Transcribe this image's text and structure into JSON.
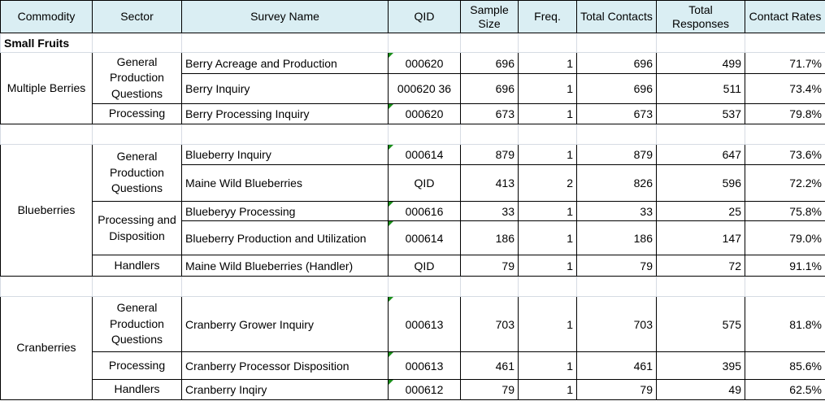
{
  "headers": [
    "Commodity",
    "Sector",
    "Survey Name",
    "QID",
    "Sample Size",
    "Freq.",
    "Total Contacts",
    "Total Responses",
    "Contact Rates"
  ],
  "section_title": "Small Fruits",
  "colors": {
    "header_bg": "#daeef3",
    "note_marker": "#1a8f1a"
  },
  "groups": [
    {
      "commodity": "Multiple Berries",
      "sectors": [
        {
          "name": "General Production Questions",
          "surveys": [
            {
              "name": "Berry Acreage and Production",
              "qid": "000620",
              "sample": "696",
              "freq": "1",
              "contacts": "696",
              "responses": "499",
              "rate": "71.7%",
              "note": true
            },
            {
              "name": "Berry Inquiry",
              "qid": "000620 36",
              "sample": "696",
              "freq": "1",
              "contacts": "696",
              "responses": "511",
              "rate": "73.4%",
              "note": false
            }
          ]
        },
        {
          "name": "Processing",
          "surveys": [
            {
              "name": "Berry Processing Inquiry",
              "qid": "000620",
              "sample": "673",
              "freq": "1",
              "contacts": "673",
              "responses": "537",
              "rate": "79.8%",
              "note": true
            }
          ]
        }
      ]
    },
    {
      "commodity": "Blueberries",
      "sectors": [
        {
          "name": "General Production Questions",
          "surveys": [
            {
              "name": "Blueberry Inquiry",
              "qid": "000614",
              "sample": "879",
              "freq": "1",
              "contacts": "879",
              "responses": "647",
              "rate": "73.6%",
              "note": true
            },
            {
              "name": "Maine Wild Blueberries",
              "qid": "QID",
              "sample": "413",
              "freq": "2",
              "contacts": "826",
              "responses": "596",
              "rate": "72.2%",
              "note": false
            }
          ]
        },
        {
          "name": "Processing and Disposition",
          "surveys": [
            {
              "name": "Blueberyy Processing",
              "qid": "000616",
              "sample": "33",
              "freq": "1",
              "contacts": "33",
              "responses": "25",
              "rate": "75.8%",
              "note": true
            },
            {
              "name": "Blueberry Production and Utilization",
              "qid": "000614",
              "sample": "186",
              "freq": "1",
              "contacts": "186",
              "responses": "147",
              "rate": "79.0%",
              "note": true
            }
          ]
        },
        {
          "name": "Handlers",
          "surveys": [
            {
              "name": "Maine Wild Blueberries (Handler)",
              "qid": "QID",
              "sample": "79",
              "freq": "1",
              "contacts": "79",
              "responses": "72",
              "rate": "91.1%",
              "note": false
            }
          ]
        }
      ]
    },
    {
      "commodity": "Cranberries",
      "sectors": [
        {
          "name": "General Production Questions",
          "surveys": [
            {
              "name": "Cranberry Grower Inquiry",
              "qid": "000613",
              "sample": "703",
              "freq": "1",
              "contacts": "703",
              "responses": "575",
              "rate": "81.8%",
              "note": true
            }
          ]
        },
        {
          "name": "Processing",
          "surveys": [
            {
              "name": "Cranberry Processor Disposition",
              "qid": "000613",
              "sample": "461",
              "freq": "1",
              "contacts": "461",
              "responses": "395",
              "rate": "85.6%",
              "note": true
            }
          ]
        },
        {
          "name": "Handlers",
          "surveys": [
            {
              "name": "Cranberry Inqiry",
              "qid": "000612",
              "sample": "79",
              "freq": "1",
              "contacts": "79",
              "responses": "49",
              "rate": "62.5%",
              "note": true
            }
          ]
        }
      ]
    }
  ]
}
